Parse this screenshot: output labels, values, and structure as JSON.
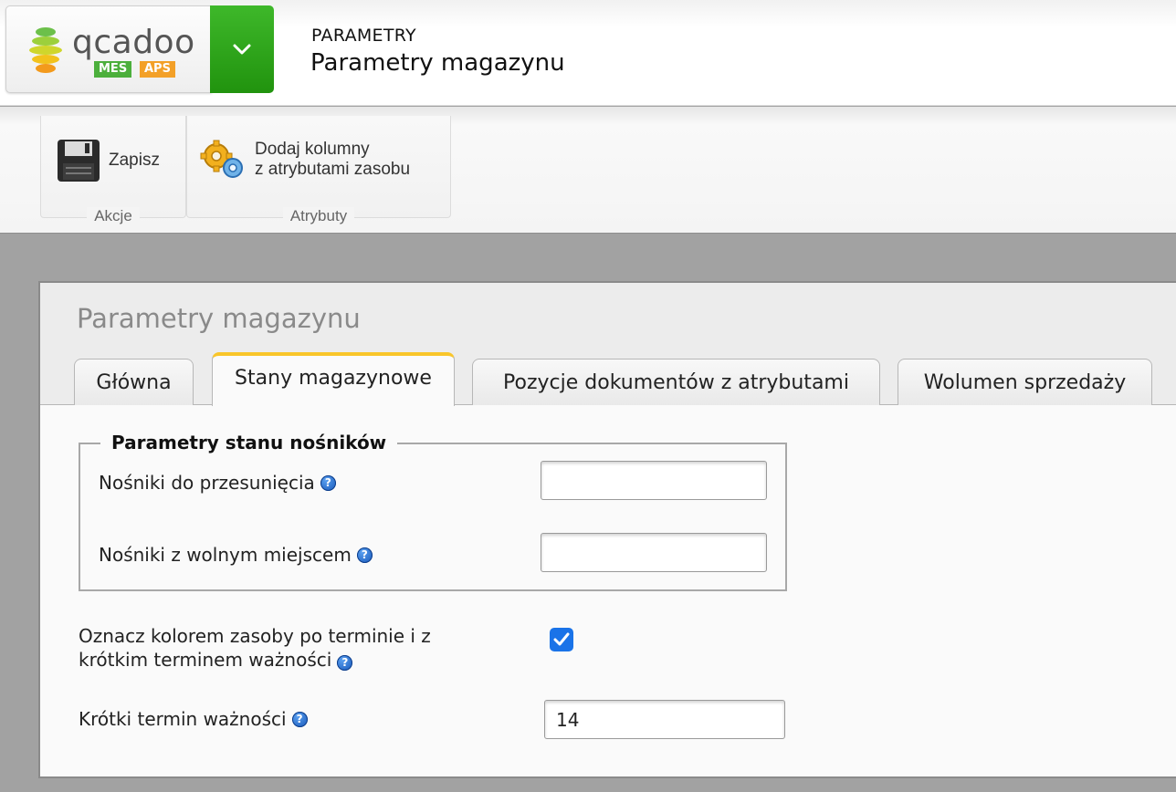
{
  "header": {
    "logo_text": "qcadoo",
    "badge_mes": "MES",
    "badge_aps": "APS",
    "breadcrumb": "PARAMETRY",
    "title": "Parametry magazynu"
  },
  "ribbon": {
    "groups": [
      {
        "caption": "Akcje",
        "buttons": [
          {
            "label": "Zapisz",
            "icon": "floppy-disk-icon"
          }
        ]
      },
      {
        "caption": "Atrybuty",
        "buttons": [
          {
            "label_line1": "Dodaj kolumny",
            "label_line2": "z atrybutami zasobu",
            "icon": "gears-icon"
          }
        ]
      }
    ]
  },
  "panel": {
    "title": "Parametry magazynu",
    "tabs": [
      {
        "label": "Główna",
        "active": false
      },
      {
        "label": "Stany magazynowe",
        "active": true
      },
      {
        "label": "Pozycje dokumentów z atrybutami",
        "active": false
      },
      {
        "label": "Wolumen sprzedaży",
        "active": false
      }
    ],
    "fieldset": {
      "legend": "Parametry stanu nośników",
      "fields": [
        {
          "label": "Nośniki do przesunięcia",
          "value": ""
        },
        {
          "label": "Nośniki z wolnym miejscem",
          "value": ""
        }
      ]
    },
    "color_expired": {
      "label_line1": "Oznacz kolorem zasoby po terminie i z",
      "label_line2": "krótkim terminem ważności",
      "checked": true
    },
    "short_expiry": {
      "label": "Krótki termin ważności",
      "value": "14"
    },
    "help_glyph": "?"
  },
  "colors": {
    "accent_green": "#21930e",
    "active_tab": "#f9c62a",
    "checkbox": "#1a73e8"
  }
}
